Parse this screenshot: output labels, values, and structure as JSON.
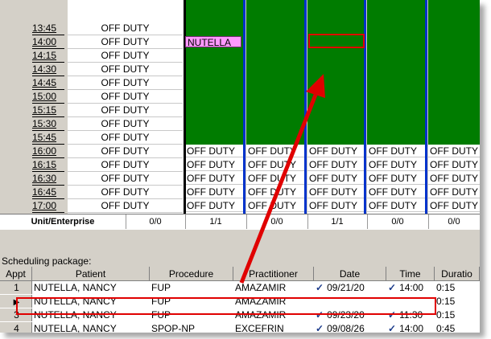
{
  "schedule": {
    "times": [
      "13:45",
      "14:00",
      "14:15",
      "14:30",
      "14:45",
      "15:00",
      "15:15",
      "15:30",
      "15:45",
      "16:00",
      "16:15",
      "16:30",
      "16:45",
      "17:00"
    ],
    "off_duty_label": "OFF DUTY",
    "appointment_label": "NUTELLA",
    "totals_label": "Unit/Enterprise",
    "totals": [
      "0/0",
      "1/1",
      "0/0",
      "1/1",
      "0/0",
      "0/0"
    ]
  },
  "package": {
    "label": "Scheduling package:",
    "columns": [
      "Appt",
      "Patient",
      "Procedure",
      "Practitioner",
      "Date",
      "Time",
      "Duratio"
    ],
    "rows": [
      {
        "appt": "1",
        "patient": "NUTELLA, NANCY",
        "procedure": "FUP",
        "practitioner": "AMAZAMIR",
        "date": "09/21/20",
        "time": "14:00",
        "duration": "0:15",
        "checked": true,
        "current": false
      },
      {
        "appt": "",
        "patient": "NUTELLA, NANCY",
        "procedure": "FUP",
        "practitioner": "AMAZAMIR",
        "date": "",
        "time": "",
        "duration": "0:15",
        "checked": false,
        "current": true
      },
      {
        "appt": "3",
        "patient": "NUTELLA, NANCY",
        "procedure": "FUP",
        "practitioner": "AMAZAMIR",
        "date": "09/23/20",
        "time": "11:30",
        "duration": "0:15",
        "checked": true,
        "current": false
      },
      {
        "appt": "4",
        "patient": "NUTELLA, NANCY",
        "procedure": "SPOP-NP",
        "practitioner": "EXCEFRIN",
        "date": "09/08/26",
        "time": "14:00",
        "duration": "0:45",
        "checked": true,
        "current": false
      }
    ]
  },
  "icons": {
    "check": "checkmark-icon",
    "pointer": "row-pointer-icon"
  },
  "colors": {
    "booked_green": "#007c00",
    "appointment_pink": "#ff99ff",
    "annotation_red": "#e00000",
    "column_blue": "#0033cc"
  }
}
